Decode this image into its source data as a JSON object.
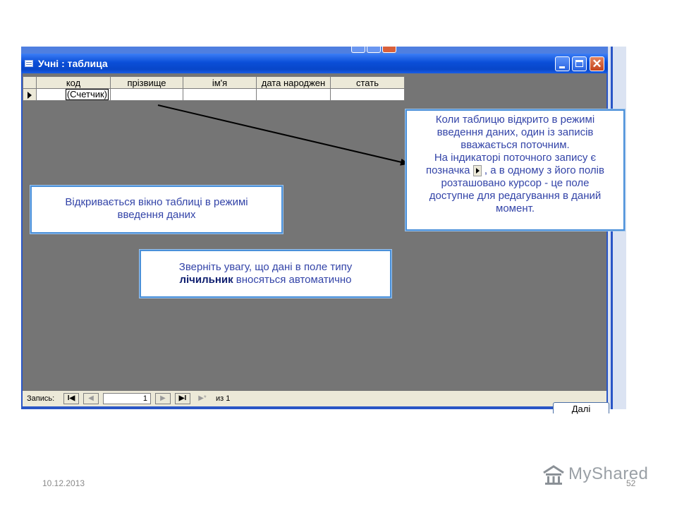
{
  "window": {
    "title": "Учні : таблица"
  },
  "table": {
    "columns": [
      "код",
      "прізвище",
      "ім'я",
      "дата народжен",
      "стать"
    ],
    "rows": [
      [
        "(Счетчик)",
        "",
        "",
        "",
        ""
      ]
    ]
  },
  "callouts": {
    "right": {
      "line1": "Коли таблицю відкрито в режимі",
      "line2": "введення даних, один із записів",
      "line3": "вважається поточним.",
      "line4": "На індикаторі поточного запису є",
      "line5_before": "позначка",
      "line5_after": ", а в одному з його полів",
      "line6": "розташовано курсор - це поле",
      "line7": "доступне для редагування в даний",
      "line8": "момент."
    },
    "left": {
      "line1": "Відкривається вікно таблиці в режимі",
      "line2": "введення даних"
    },
    "center": {
      "line1": "Зверніть увагу, що дані в поле типу",
      "line2_bold": "лічильник",
      "line2_rest": " вносяться автоматично"
    }
  },
  "statusbar": {
    "label": "Запись:",
    "current_record": "1",
    "of_label": "из 1",
    "nav_first": "I◀",
    "nav_prev": "◀",
    "nav_next": "▶",
    "nav_last": "▶I",
    "nav_new": "▶*"
  },
  "peek_button": "Далі",
  "footer": {
    "date": "10.12.2013",
    "slide_number": "52",
    "logo_text": "MyShared"
  },
  "colors": {
    "titlebar": "#0a4ed8",
    "client_bg": "#757575",
    "callout_border": "#4a90d9",
    "callout_text": "#3344a8"
  },
  "icons": {
    "window": "table-window-icon",
    "record_selector": "current-record-arrow-icon",
    "logo": "myshared-logo-icon"
  }
}
